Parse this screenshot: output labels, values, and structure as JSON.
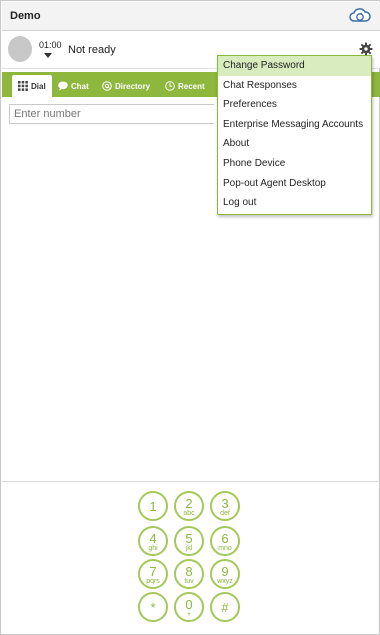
{
  "app": {
    "title": "Demo"
  },
  "status": {
    "timer": "01:00",
    "state": "Not ready"
  },
  "tabs": [
    {
      "label": "Dial",
      "icon": "grid-icon",
      "active": true
    },
    {
      "label": "Chat",
      "icon": "chat-bubble-icon",
      "active": false
    },
    {
      "label": "Directory",
      "icon": "at-icon",
      "active": false
    },
    {
      "label": "Recent",
      "icon": "clock-icon",
      "active": false
    }
  ],
  "dial": {
    "placeholder": "Enter number"
  },
  "menu": {
    "items": [
      {
        "label": "Change Password"
      },
      {
        "label": "Chat Responses"
      },
      {
        "label": "Preferences"
      },
      {
        "label": "Enterprise Messaging Accounts"
      },
      {
        "label": "About"
      },
      {
        "label": "Phone Device"
      },
      {
        "label": "Pop-out Agent Desktop"
      },
      {
        "label": "Log out"
      }
    ],
    "highlighted_index": 0
  },
  "keypad": {
    "keys": [
      {
        "digit": "1",
        "letters": ""
      },
      {
        "digit": "2",
        "letters": "abc"
      },
      {
        "digit": "3",
        "letters": "def"
      },
      {
        "digit": "4",
        "letters": "ghi"
      },
      {
        "digit": "5",
        "letters": "jkl"
      },
      {
        "digit": "6",
        "letters": "mno"
      },
      {
        "digit": "7",
        "letters": "pqrs"
      },
      {
        "digit": "8",
        "letters": "tuv"
      },
      {
        "digit": "9",
        "letters": "wxyz"
      },
      {
        "digit": "*",
        "letters": ""
      },
      {
        "digit": "0",
        "letters": "+"
      },
      {
        "digit": "#",
        "letters": ""
      }
    ]
  },
  "colors": {
    "accent": "#8db73d",
    "menu_hover": "#d9ecbf",
    "keypad_ring": "#a5c85a"
  }
}
